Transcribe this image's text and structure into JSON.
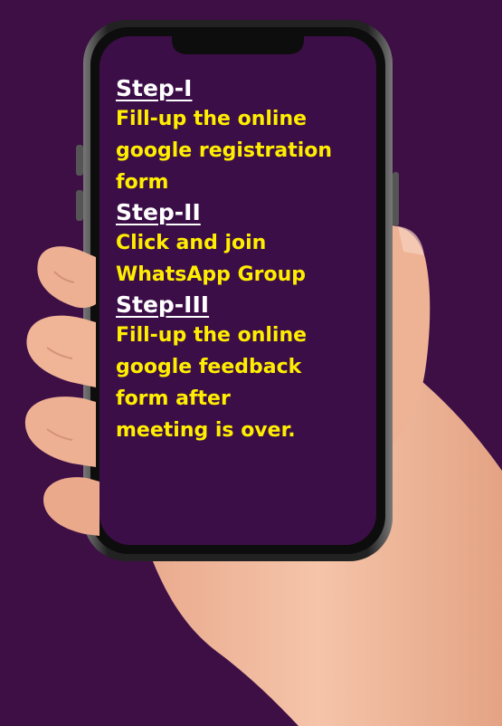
{
  "steps": [
    {
      "heading": "Step-I",
      "lines": [
        "Fill-up the online",
        "google registration",
        "form"
      ]
    },
    {
      "heading": "Step-II",
      "lines": [
        "Click and join",
        "WhatsApp Group"
      ]
    },
    {
      "heading": "Step-III",
      "lines": [
        "Fill-up the online",
        "google feedback",
        "form after",
        "meeting is over."
      ]
    }
  ],
  "colors": {
    "background": "#3d0f45",
    "screen": "#3c0e47",
    "heading": "#ffffff",
    "step_text": "#ffee00",
    "skin": "#f0b79d",
    "phone_frame": "#1a1a1a"
  }
}
